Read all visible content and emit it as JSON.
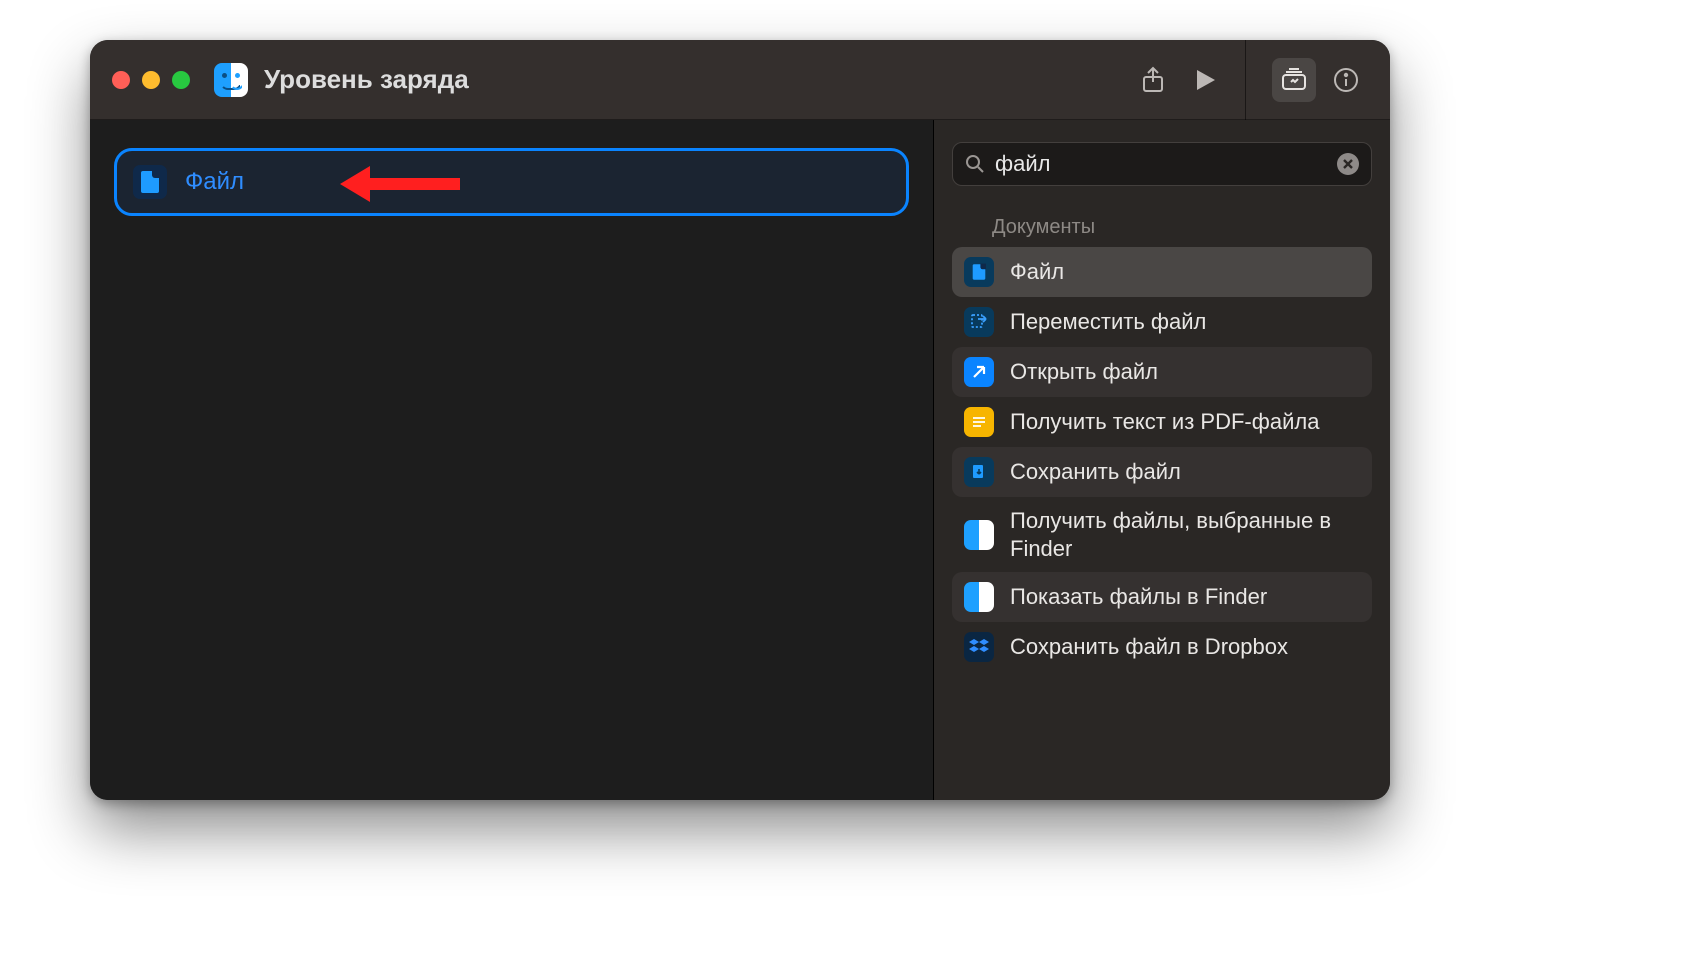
{
  "header": {
    "title": "Уровень заряда"
  },
  "canvas": {
    "tile_label": "Файл"
  },
  "sidebar": {
    "search_value": "файл",
    "section_label": "Документы",
    "results": [
      {
        "label": "Файл",
        "icon": "file"
      },
      {
        "label": "Переместить файл",
        "icon": "move"
      },
      {
        "label": "Открыть файл",
        "icon": "open"
      },
      {
        "label": "Получить текст из PDF-файла",
        "icon": "pdf"
      },
      {
        "label": "Сохранить файл",
        "icon": "save"
      },
      {
        "label": "Получить файлы, выбранные в Finder",
        "icon": "finder"
      },
      {
        "label": "Показать файлы в Finder",
        "icon": "finder"
      },
      {
        "label": "Сохранить файл в Dropbox",
        "icon": "dropbox"
      }
    ]
  }
}
